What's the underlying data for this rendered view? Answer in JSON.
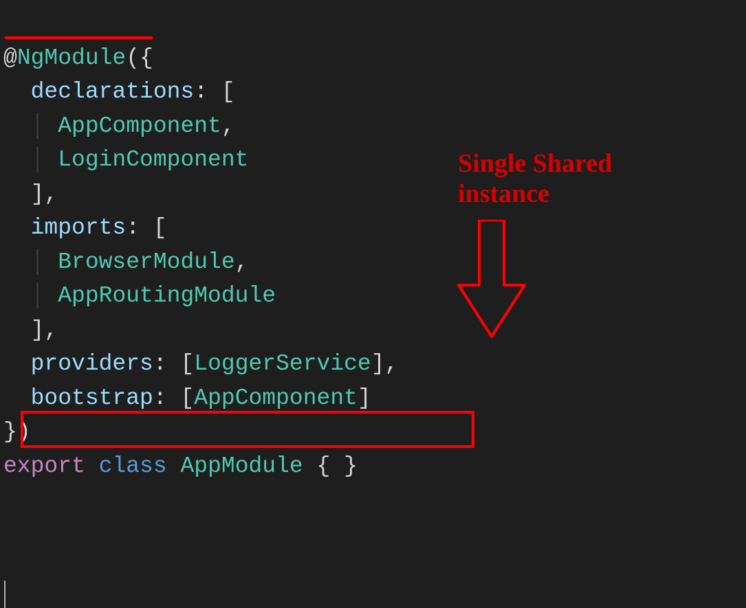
{
  "code": {
    "decorator": "NgModule",
    "at": "@",
    "properties": {
      "declarations": {
        "key": "declarations",
        "items": [
          "AppComponent",
          "LoginComponent"
        ]
      },
      "imports": {
        "key": "imports",
        "items": [
          "BrowserModule",
          "AppRoutingModule"
        ]
      },
      "providers": {
        "key": "providers",
        "items": [
          "LoggerService"
        ]
      },
      "bootstrap": {
        "key": "bootstrap",
        "items": [
          "AppComponent"
        ]
      }
    },
    "export_kw": "export",
    "class_kw": "class",
    "classname": "AppModule"
  },
  "annotation": {
    "line1": "Single Shared",
    "line2": "instance"
  }
}
